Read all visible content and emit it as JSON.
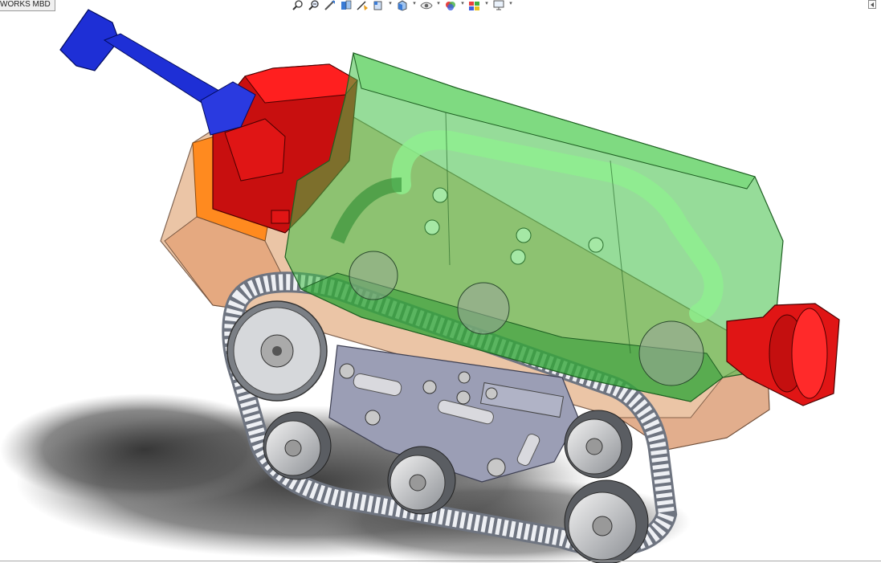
{
  "window": {
    "tab_label": "WORKS MBD"
  },
  "toolbar": {
    "buttons": [
      {
        "id": "zoom-to-fit",
        "icon": "zoom-to-fit-icon"
      },
      {
        "id": "zoom-to-area",
        "icon": "zoom-to-area-icon"
      },
      {
        "id": "previous-view",
        "icon": "previous-view-icon"
      },
      {
        "id": "section-view",
        "icon": "section-view-icon"
      },
      {
        "id": "dynamic-annotation",
        "icon": "dynamic-annotation-icon"
      },
      {
        "id": "view-orientation",
        "icon": "view-orientation-icon",
        "has_menu": true
      },
      {
        "id": "display-style",
        "icon": "display-style-icon",
        "has_menu": true
      },
      {
        "id": "hide-show-items",
        "icon": "eye-icon",
        "has_menu": true
      },
      {
        "id": "edit-appearance",
        "icon": "edit-appearance-icon",
        "has_menu": true
      },
      {
        "id": "apply-scene",
        "icon": "apply-scene-icon",
        "has_menu": true
      },
      {
        "id": "view-settings",
        "icon": "monitor-icon",
        "has_menu": true
      }
    ]
  },
  "colors": {
    "hull_green": "#5fcf63",
    "hull_green_dark": "#2f8c34",
    "turret_red": "#e01515",
    "barrel_blue": "#1f2fd0",
    "base_peach": "#e6b48e",
    "base_orange": "#ff8a1f",
    "track_grey": "#c9cdd4",
    "wheel_grey": "#bfc2c6",
    "frame_lilac": "#8c8fa8",
    "shadow": "#4a4a4a"
  }
}
